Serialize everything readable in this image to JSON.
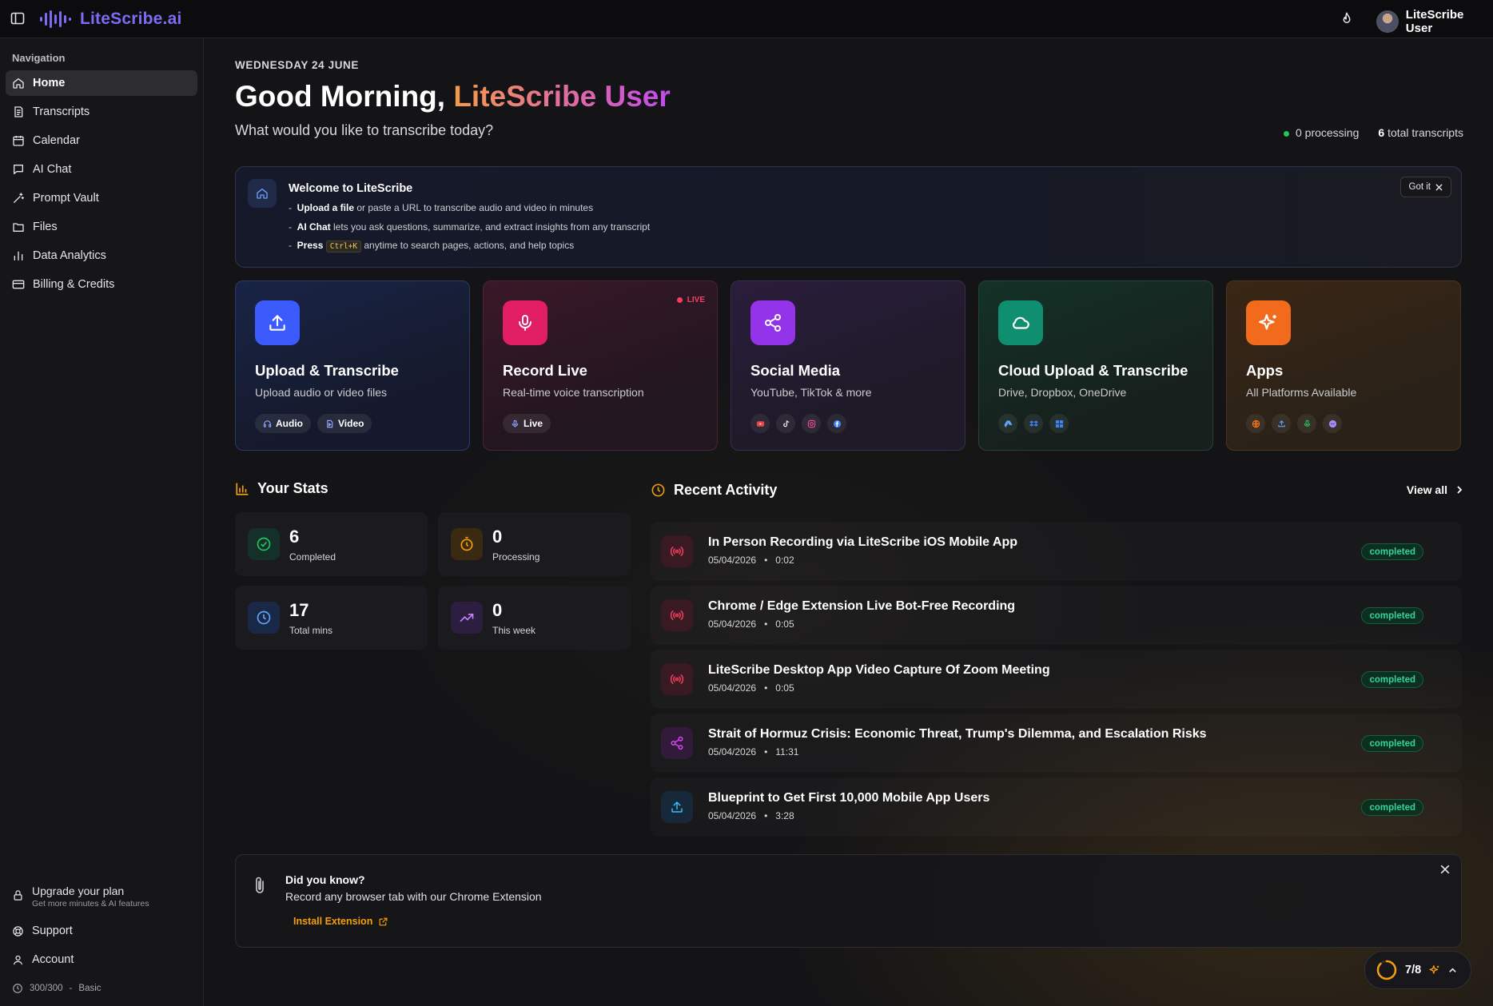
{
  "app": {
    "brand": "LiteScribe.ai",
    "user_name": "LiteScribe User"
  },
  "sidebar": {
    "title": "Navigation",
    "items": [
      {
        "label": "Home",
        "icon": "home-icon"
      },
      {
        "label": "Transcripts",
        "icon": "transcripts-icon"
      },
      {
        "label": "Calendar",
        "icon": "calendar-icon"
      },
      {
        "label": "AI Chat",
        "icon": "chat-icon"
      },
      {
        "label": "Prompt Vault",
        "icon": "wand-icon"
      },
      {
        "label": "Files",
        "icon": "folder-icon"
      },
      {
        "label": "Data Analytics",
        "icon": "bar-chart-icon"
      },
      {
        "label": "Billing & Credits",
        "icon": "credit-card-icon"
      }
    ],
    "upgrade_title": "Upgrade your plan",
    "upgrade_sub": "Get more minutes & AI features",
    "support": "Support",
    "account": "Account",
    "credits": "300/300",
    "plan": "Basic"
  },
  "header": {
    "date": "WEDNESDAY 24 JUNE",
    "greeting": "Good Morning,",
    "greeting_name": "LiteScribe User",
    "subtitle": "What would you like to transcribe today?",
    "processing": "0 processing",
    "total_count": "6",
    "total_label": "total transcripts"
  },
  "welcome": {
    "title": "Welcome to LiteScribe",
    "items": [
      {
        "bold": "Upload a file",
        "text": " or paste a URL to transcribe audio and video in minutes"
      },
      {
        "bold": "AI Chat",
        "text": " lets you ask questions, summarize, and extract insights from any transcript"
      },
      {
        "bold": "Press",
        "kbd": "Ctrl+K",
        "text": " anytime to search pages, actions, and help topics"
      }
    ],
    "dismiss": "Got it"
  },
  "cards": [
    {
      "title": "Upload & Transcribe",
      "desc": "Upload audio or video files",
      "chips": [
        "Audio",
        "Video"
      ],
      "color": "#3b5bfd"
    },
    {
      "title": "Record Live",
      "desc": "Real-time voice transcription",
      "chips": [
        "Live"
      ],
      "badge": "LIVE",
      "color": "#e11d63"
    },
    {
      "title": "Social Media",
      "desc": "YouTube, TikTok & more",
      "color": "#9333ea"
    },
    {
      "title": "Cloud Upload & Transcribe",
      "desc": "Drive, Dropbox, OneDrive",
      "color": "#0f8f70"
    },
    {
      "title": "Apps",
      "desc": "All Platforms Available",
      "color": "#f26b1d"
    }
  ],
  "stats": {
    "title": "Your Stats",
    "items": [
      {
        "value": "6",
        "label": "Completed"
      },
      {
        "value": "0",
        "label": "Processing"
      },
      {
        "value": "17",
        "label": "Total mins"
      },
      {
        "value": "0",
        "label": "This week"
      }
    ]
  },
  "activity": {
    "title": "Recent Activity",
    "view_all": "View all",
    "rows": [
      {
        "title": "In Person Recording via LiteScribe iOS Mobile App",
        "date": "05/04/2026",
        "duration": "0:02",
        "status": "completed",
        "icon": "broadcast-icon"
      },
      {
        "title": "Chrome / Edge Extension Live Bot-Free Recording",
        "date": "05/04/2026",
        "duration": "0:05",
        "status": "completed",
        "icon": "broadcast-icon"
      },
      {
        "title": "LiteScribe Desktop App Video Capture Of Zoom Meeting",
        "date": "05/04/2026",
        "duration": "0:05",
        "status": "completed",
        "icon": "broadcast-icon"
      },
      {
        "title": "Strait of Hormuz Crisis: Economic Threat, Trump's Dilemma, and Escalation Risks",
        "date": "05/04/2026",
        "duration": "11:31",
        "status": "completed",
        "icon": "share-icon"
      },
      {
        "title": "Blueprint to Get First 10,000 Mobile App Users",
        "date": "05/04/2026",
        "duration": "3:28",
        "status": "completed",
        "icon": "upload-icon"
      }
    ]
  },
  "tip": {
    "title": "Did you know?",
    "text": "Record any browser tab with our Chrome Extension",
    "link": "Install Extension"
  },
  "onboarding": {
    "progress": "7/8",
    "fraction": 0.875
  }
}
